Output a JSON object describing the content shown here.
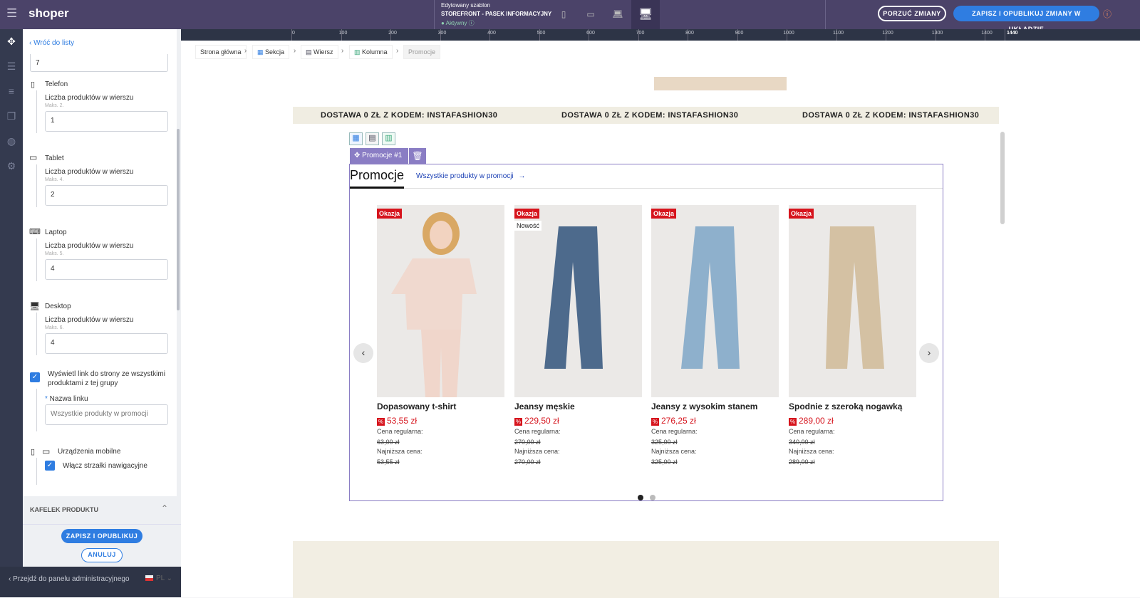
{
  "topbar": {
    "logo": "shoper",
    "edited_label": "Edytowany szablon",
    "template_name": "STOREFRONT - PASEK INFORMACYJNY",
    "status": "Aktywny",
    "discard": "PORZUĆ ZMIANY",
    "publish": "ZAPISZ I OPUBLIKUJ ZMIANY W UKŁADZIE"
  },
  "panel": {
    "back": "Wróć do listy",
    "top_value": "7",
    "devices": [
      {
        "name": "Telefon",
        "label": "Liczba produktów w wierszu",
        "hint": "Maks. 2.",
        "value": "1"
      },
      {
        "name": "Tablet",
        "label": "Liczba produktów w wierszu",
        "hint": "Maks. 4.",
        "value": "2"
      },
      {
        "name": "Laptop",
        "label": "Liczba produktów w wierszu",
        "hint": "Maks. 5.",
        "value": "4"
      },
      {
        "name": "Desktop",
        "label": "Liczba produktów w wierszu",
        "hint": "Maks. 6.",
        "value": "4"
      }
    ],
    "show_link": "Wyświetl link do strony ze wszystkimi produktami z tej grupy",
    "link_name_label": "Nazwa linku",
    "link_name_value": "Wszystkie produkty w promocji",
    "mobile_label": "Urządzenia mobilne",
    "arrows_label": "Włącz strzałki nawigacyjne",
    "section": "KAFELEK PRODUKTU",
    "save": "ZAPISZ I OPUBLIKUJ",
    "cancel": "ANULUJ"
  },
  "bottom": {
    "admin_link": "Przejdź do panelu administracyjnego",
    "lang": "PL"
  },
  "ruler": [
    "0",
    "100",
    "200",
    "300",
    "400",
    "500",
    "600",
    "700",
    "800",
    "900",
    "1000",
    "1100",
    "1200",
    "1300",
    "1400",
    "1440"
  ],
  "breadcrumb": [
    "Strona główna",
    "Sekcja",
    "Wiersz",
    "Kolumna",
    "Promocje"
  ],
  "bar_text": "DOSTAWA 0 ZŁ Z KODEM: INSTAFASHION30",
  "module": {
    "tag": "Promocje #1",
    "title": "Promocje",
    "all_link": "Wszystkie produkty w promocji"
  },
  "products": [
    {
      "badge": "Okazja",
      "badge2": "",
      "name": "Dopasowany t-shirt",
      "price": "53,55 zł",
      "regular_label": "Cena regularna:",
      "regular": "63,00 zł",
      "lowest_label": "Najniższa cena:",
      "lowest": "53,55 zł",
      "color": "#f0d9cf"
    },
    {
      "badge": "Okazja",
      "badge2": "Nowość",
      "name": "Jeansy męskie",
      "price": "229,50 zł",
      "regular_label": "Cena regularna:",
      "regular": "270,00 zł",
      "lowest_label": "Najniższa cena:",
      "lowest": "270,00 zł",
      "color": "#4d6a8c"
    },
    {
      "badge": "Okazja",
      "badge2": "",
      "name": "Jeansy z wysokim stanem",
      "price": "276,25 zł",
      "regular_label": "Cena regularna:",
      "regular": "325,00 zł",
      "lowest_label": "Najniższa cena:",
      "lowest": "325,00 zł",
      "color": "#8eb0cc"
    },
    {
      "badge": "Okazja",
      "badge2": "",
      "name": "Spodnie z szeroką nogawką",
      "price": "289,00 zł",
      "regular_label": "Cena regularna:",
      "regular": "340,00 zł",
      "lowest_label": "Najniższa cena:",
      "lowest": "289,00 zł",
      "color": "#d4c1a3"
    }
  ]
}
